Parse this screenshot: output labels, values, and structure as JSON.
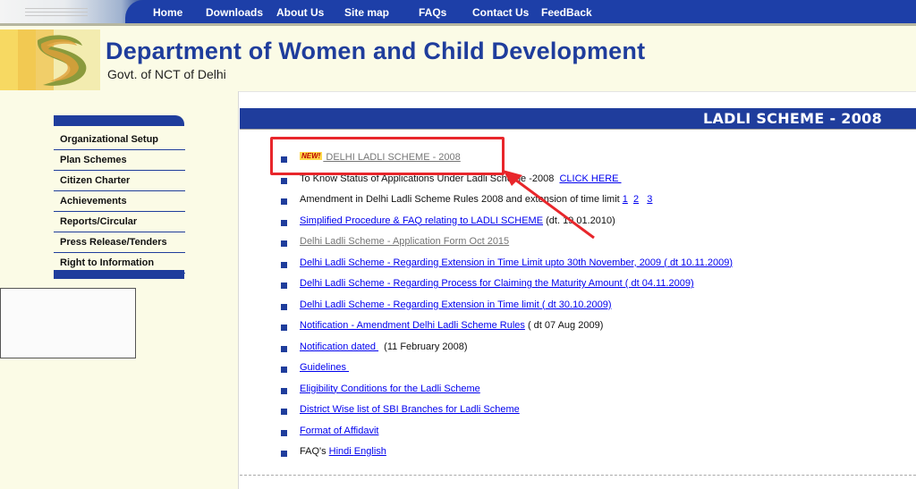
{
  "nav": {
    "items": [
      "Home",
      "Downloads",
      "About Us",
      "Site map",
      "FAQs",
      "Contact Us",
      "FeedBack"
    ]
  },
  "header": {
    "title": "Department of Women and Child Development",
    "subtitle": "Govt. of NCT of Delhi"
  },
  "sidebar": {
    "items": [
      "Organizational Setup",
      "Plan Schemes",
      "Citizen Charter",
      "Achievements",
      "Reports/Circular",
      "Press Release/Tenders",
      "Right to Information"
    ]
  },
  "main": {
    "title": "LADLI SCHEME - 2008",
    "new_badge": "NEW!",
    "items": [
      {
        "link": " DELHI LADLI SCHEME - 2008"
      },
      {
        "pre": "To Know Status of Applications Under Ladli Scheme -2008  ",
        "link": "CLICK HERE "
      },
      {
        "pre": "Amendment in Delhi Ladli Scheme Rules 2008 and extension of time limit ",
        "links": [
          "1",
          "2",
          "3"
        ]
      },
      {
        "link": "Simplified Procedure & FAQ relating to LADLI SCHEME",
        "post": " (dt. 19.01.2010)"
      },
      {
        "link": "Delhi Ladli Scheme - Application Form Oct 2015"
      },
      {
        "link": "Delhi Ladli Scheme - Regarding Extension in Time Limit upto 30th November, 2009 ( dt 10.11.2009)"
      },
      {
        "link": "Delhi Ladli Scheme - Regarding Process for Claiming the Maturity Amount ( dt 04.11.2009)"
      },
      {
        "link": "Delhi Ladli Scheme - Regarding Extension in Time limit ( dt 30.10.2009)"
      },
      {
        "link": "Notification - Amendment Delhi Ladli Scheme Rules",
        "post": " ( dt 07 Aug 2009)"
      },
      {
        "link": "Notification dated ",
        "post": "  (11 February 2008)"
      },
      {
        "link": "Guidelines "
      },
      {
        "link": "Eligibility Conditions for the Ladli Scheme"
      },
      {
        "link": "District Wise list of SBI Branches for Ladli Scheme"
      },
      {
        "link": "Format of Affidavit"
      },
      {
        "pre": "FAQ's ",
        "links": [
          "Hindi ",
          "English"
        ]
      }
    ]
  },
  "colors": {
    "nav_blue": "#1d3fa8",
    "cream": "#fbfbe6",
    "highlight_red": "#e8262b"
  }
}
